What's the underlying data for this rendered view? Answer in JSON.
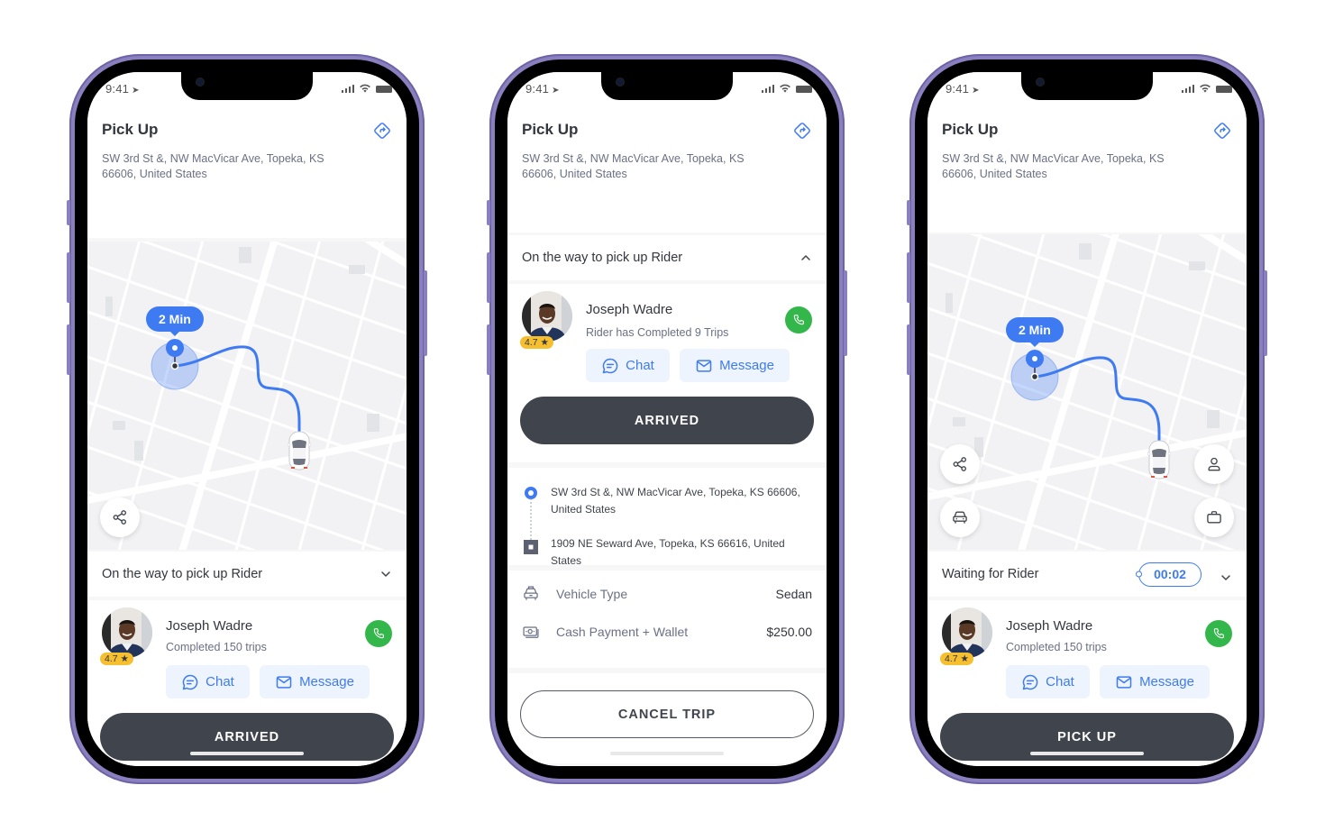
{
  "status_bar": {
    "time": "9:41"
  },
  "colors": {
    "accent": "#3e7bf2",
    "call": "#34b74a",
    "rating": "#f5bf30",
    "primary_button": "#40444d",
    "frame": "#8a80bf"
  },
  "screens": [
    {
      "header": {
        "title": "Pick Up",
        "address": "SW 3rd St &, NW MacVicar Ave, Topeka, KS 66606, United States"
      },
      "map": {
        "eta_label": "2 Min",
        "buttons": [
          "share-icon"
        ]
      },
      "status_strip": {
        "label": "On the way to pick up Rider",
        "chevron": "chevron-down-icon"
      },
      "rider": {
        "name": "Joseph Wadre",
        "subtitle": "Completed 150 trips",
        "rating": "4.7 ★",
        "chat_label": "Chat",
        "message_label": "Message"
      },
      "primary_action": "ARRIVED"
    },
    {
      "header": {
        "title": "Pick Up",
        "address": "SW 3rd St &, NW MacVicar Ave, Topeka, KS 66606, United States"
      },
      "status_strip": {
        "label": "On the way to pick up Rider",
        "chevron": "chevron-up-icon"
      },
      "rider": {
        "name": "Joseph Wadre",
        "subtitle": "Rider has Completed 9 Trips",
        "rating": "4.7 ★",
        "chat_label": "Chat",
        "message_label": "Message"
      },
      "primary_action": "ARRIVED",
      "route": {
        "pickup": "SW 3rd St &, NW MacVicar Ave, Topeka, KS 66606, United States",
        "dropoff": "1909 NE Seward Ave, Topeka, KS 66616, United States"
      },
      "trip_info": [
        {
          "icon": "taxi-icon",
          "label": "Vehicle Type",
          "value": "Sedan"
        },
        {
          "icon": "cash-icon",
          "label": "Cash Payment + Wallet",
          "value": "$250.00"
        }
      ],
      "secondary_action": "CANCEL TRIP"
    },
    {
      "header": {
        "title": "Pick Up",
        "address": "SW 3rd St &, NW MacVicar Ave, Topeka, KS 66606, United States"
      },
      "map": {
        "eta_label": "2 Min",
        "buttons": [
          "share-icon",
          "car-icon",
          "user-icon",
          "briefcase-icon"
        ]
      },
      "status_strip": {
        "label": "Waiting for Rider",
        "timer": "00:02",
        "chevron": "chevron-down-icon"
      },
      "rider": {
        "name": "Joseph Wadre",
        "subtitle": "Completed 150 trips",
        "rating": "4.7 ★",
        "chat_label": "Chat",
        "message_label": "Message"
      },
      "primary_action": "PICK UP"
    }
  ]
}
